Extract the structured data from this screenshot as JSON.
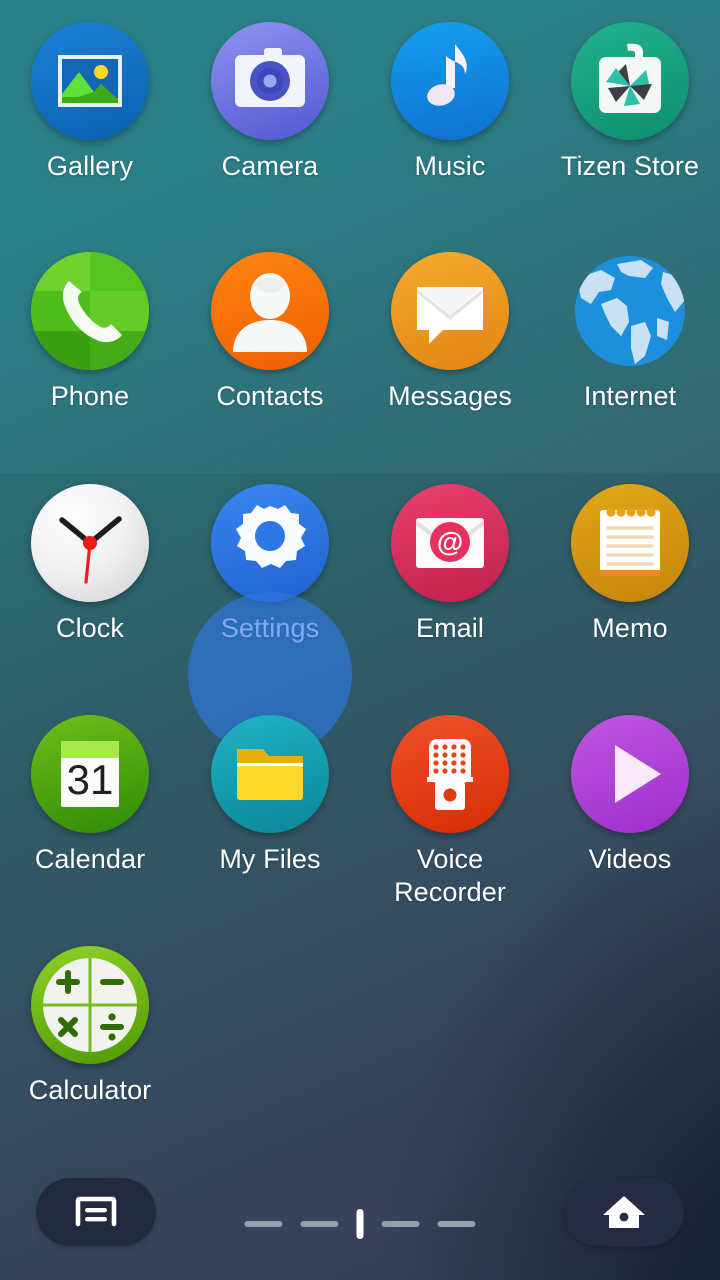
{
  "screen": {
    "type": "app-drawer",
    "background": {
      "gradient_from": "#2a8089",
      "gradient_to": "#3c4160",
      "corner_shade": "#1e2338"
    }
  },
  "apps": [
    {
      "label": "Gallery",
      "icon": "gallery-icon",
      "color": "#0f72c8",
      "row": 1,
      "col": 1,
      "pressed": false
    },
    {
      "label": "Camera",
      "icon": "camera-icon",
      "color": "#6d72e0",
      "row": 1,
      "col": 2,
      "pressed": false
    },
    {
      "label": "Music",
      "icon": "music-note-icon",
      "color": "#1690e8",
      "row": 1,
      "col": 3,
      "pressed": false
    },
    {
      "label": "Tizen Store",
      "icon": "tizen-store-icon",
      "color": "#17a881",
      "row": 1,
      "col": 4,
      "pressed": false
    },
    {
      "label": "Phone",
      "icon": "phone-handset-icon",
      "color": "#4caf1e",
      "row": 2,
      "col": 1,
      "pressed": false
    },
    {
      "label": "Contacts",
      "icon": "contacts-person-icon",
      "color": "#f57000",
      "row": 2,
      "col": 2,
      "pressed": false
    },
    {
      "label": "Messages",
      "icon": "messages-bubble-icon",
      "color": "#efa023",
      "row": 2,
      "col": 3,
      "pressed": false
    },
    {
      "label": "Internet",
      "icon": "internet-globe-icon",
      "color": "#1b8fe0",
      "row": 2,
      "col": 4,
      "pressed": false
    },
    {
      "label": "Clock",
      "icon": "clock-face-icon",
      "color": "#e8e8e8",
      "row": 3,
      "col": 1,
      "pressed": false
    },
    {
      "label": "Settings",
      "icon": "settings-gear-icon",
      "color": "#2e78e8",
      "row": 3,
      "col": 2,
      "pressed": true
    },
    {
      "label": "Email",
      "icon": "email-envelope-icon",
      "color": "#d8315b",
      "row": 3,
      "col": 3,
      "pressed": false
    },
    {
      "label": "Memo",
      "icon": "memo-notepad-icon",
      "color": "#d79a12",
      "row": 3,
      "col": 4,
      "pressed": false
    },
    {
      "label": "Calendar",
      "icon": "calendar-31-icon",
      "color": "#57a813",
      "row": 4,
      "col": 1,
      "pressed": false
    },
    {
      "label": "My Files",
      "icon": "folder-icon",
      "color": "#119cb0",
      "row": 4,
      "col": 2,
      "pressed": false
    },
    {
      "label": "Voice\nRecorder",
      "icon": "microphone-icon",
      "color": "#e8411c",
      "row": 4,
      "col": 3,
      "pressed": false
    },
    {
      "label": "Videos",
      "icon": "video-play-icon",
      "color": "#ad3fd6",
      "row": 4,
      "col": 4,
      "pressed": false
    },
    {
      "label": "Calculator",
      "icon": "calculator-icon",
      "color": "#76c018",
      "row": 5,
      "col": 1,
      "pressed": false
    }
  ],
  "calendar_icon": {
    "day": "31"
  },
  "calculator_icon": {
    "symbols": [
      "+",
      "−",
      "×",
      "÷"
    ]
  },
  "email_icon": {
    "badge": "@"
  },
  "navbar": {
    "menu_button": {
      "icon": "menu-card-icon",
      "name": "Menu"
    },
    "home_button": {
      "icon": "home-icon",
      "name": "Home"
    },
    "page_indicator": {
      "total_pages": 5,
      "current_page": 3,
      "dash_color": "#96a0b0",
      "current_color": "#ffffff"
    }
  }
}
